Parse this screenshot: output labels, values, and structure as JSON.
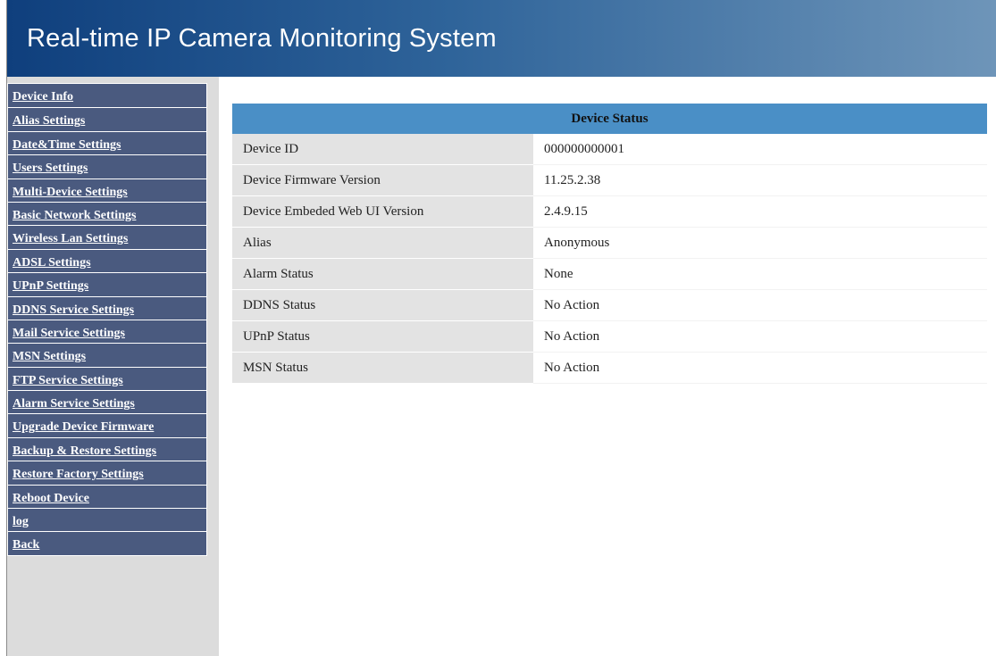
{
  "header": {
    "title": "Real-time IP Camera Monitoring System"
  },
  "sidebar": {
    "items": [
      "Device Info",
      "Alias Settings",
      "Date&Time Settings",
      "Users Settings",
      "Multi-Device Settings",
      "Basic Network Settings",
      "Wireless Lan Settings",
      "ADSL Settings",
      "UPnP Settings",
      "DDNS Service Settings",
      "Mail Service Settings",
      "MSN Settings",
      "FTP Service Settings",
      "Alarm Service Settings",
      "Upgrade Device Firmware",
      "Backup & Restore Settings",
      "Restore Factory Settings",
      "Reboot Device",
      "log",
      "Back"
    ]
  },
  "status": {
    "title": "Device Status",
    "rows": [
      {
        "label": "Device ID",
        "value": "000000000001"
      },
      {
        "label": "Device Firmware Version",
        "value": "11.25.2.38"
      },
      {
        "label": "Device Embeded Web UI Version",
        "value": "2.4.9.15"
      },
      {
        "label": "Alias",
        "value": "Anonymous"
      },
      {
        "label": "Alarm Status",
        "value": "None"
      },
      {
        "label": "DDNS Status",
        "value": "No Action"
      },
      {
        "label": "UPnP Status",
        "value": "No Action"
      },
      {
        "label": "MSN Status",
        "value": "No Action"
      }
    ]
  },
  "colors": {
    "header_start": "#0f3f7d",
    "header_end": "#6e95b9",
    "nav_bg": "#4a5a7f",
    "table_header": "#4a8fc6",
    "label_bg": "#e3e3e3",
    "sidebar_bg": "#dcdcdc"
  }
}
